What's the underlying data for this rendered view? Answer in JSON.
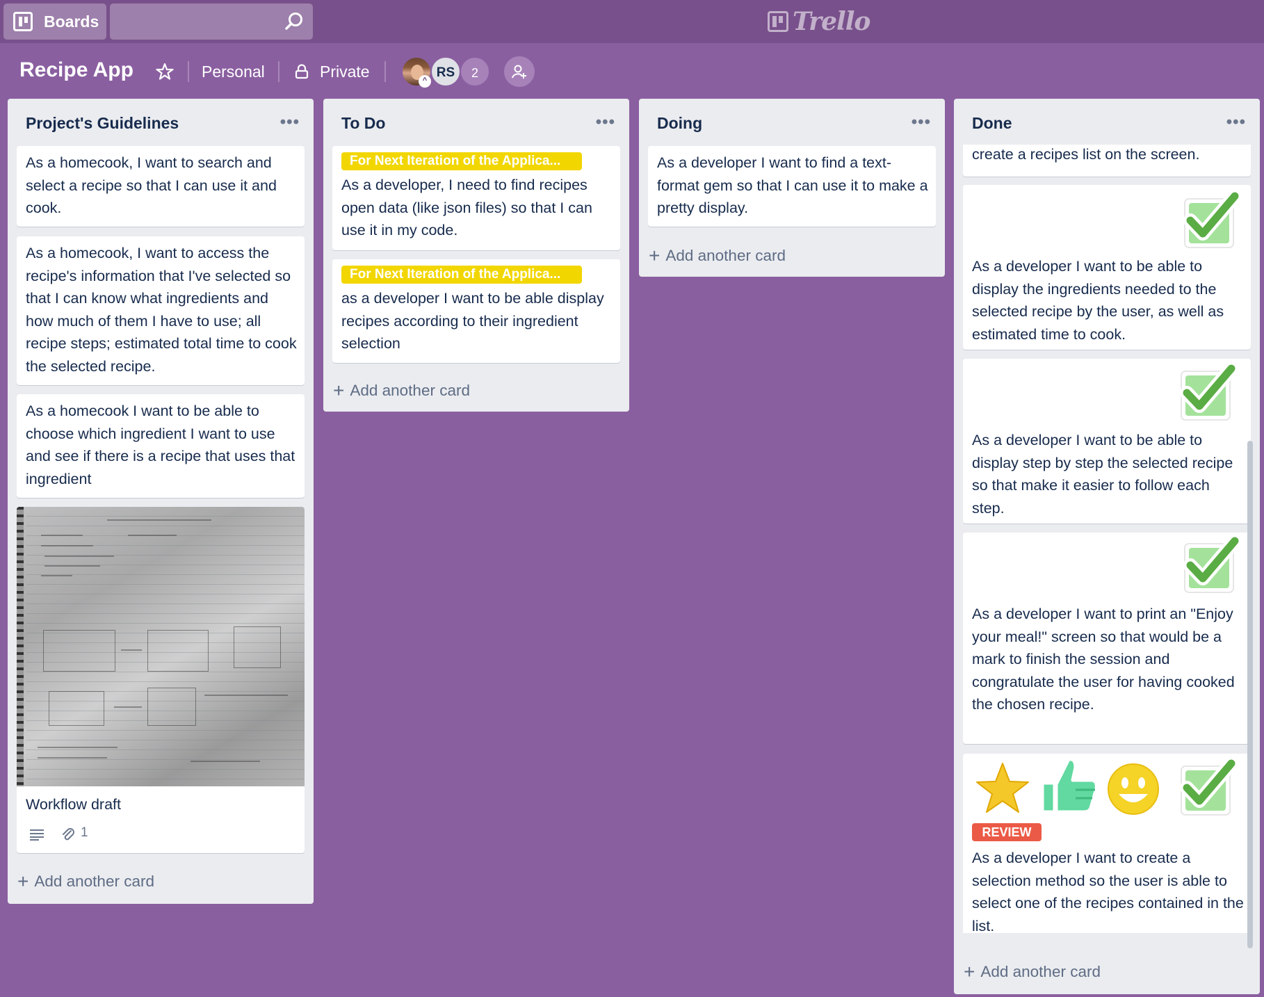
{
  "topbar": {
    "boards_label": "Boards",
    "search_value": "",
    "logo_text": "Trello"
  },
  "board": {
    "title": "Recipe App",
    "team": "Personal",
    "visibility": "Private",
    "member_initials": "RS",
    "extra_members": "2"
  },
  "lists": {
    "guidelines": {
      "title": "Project's Guidelines",
      "menu": "•••",
      "cards": [
        "As a homecook, I want to search and select a recipe so that I can use it and cook.",
        "As a homecook, I want to access the recipe's information that I've selected so that I can know what ingredients and how much of them I have to use; all recipe steps; estimated total time to cook the selected recipe.",
        "As a homecook I want to be able to choose which ingredient I want to use and see if there is a recipe that uses that ingredient"
      ],
      "workflow_card": {
        "title": "Workflow draft",
        "attachments": "1"
      },
      "add_card": "Add another card"
    },
    "todo": {
      "title": "To Do",
      "menu": "•••",
      "label": "For Next Iteration of the Applica...",
      "cards": [
        "As a developer, I need to find recipes open data (like json files) so that I can use it in my code.",
        "as a developer I want to be able display recipes according to their ingredient selection"
      ],
      "add_card": "Add another card"
    },
    "doing": {
      "title": "Doing",
      "menu": "•••",
      "cards": [
        "As a developer I want to find a text-format gem so that I can use it to make a pretty display."
      ],
      "add_card": "Add another card"
    },
    "done": {
      "title": "Done",
      "menu": "•••",
      "cards": [
        "create a recipes list on the screen.",
        "As a developer I want to be able to display the ingredients needed to the selected recipe by the user, as well as estimated time to cook.",
        "As a developer I want to be able to display step by step the selected recipe so that make it easier to follow each step.",
        "As a developer I want to print an \"Enjoy your meal!\" screen so that would be a mark to finish the session and congratulate the user for having cooked the chosen recipe.",
        "As a developer I want to create a selection method so the user is able to select one of the recipes contained in the list."
      ],
      "review_label": "REVIEW",
      "add_card": "Add another card"
    }
  },
  "colors": {
    "board_bg": "#8a5fa0",
    "topbar_bg": "#78508b",
    "list_bg": "#ebecf0",
    "label_yellow": "#f2d600",
    "label_red": "#eb5a46",
    "check_green": "#5aac44"
  },
  "icons": [
    "boards-icon",
    "search-icon",
    "trello-logo-icon",
    "star-icon",
    "lock-icon",
    "add-member-icon",
    "description-icon",
    "attachment-icon",
    "check-sticker-icon",
    "star-sticker-icon",
    "thumbs-up-sticker-icon",
    "smiley-sticker-icon"
  ]
}
